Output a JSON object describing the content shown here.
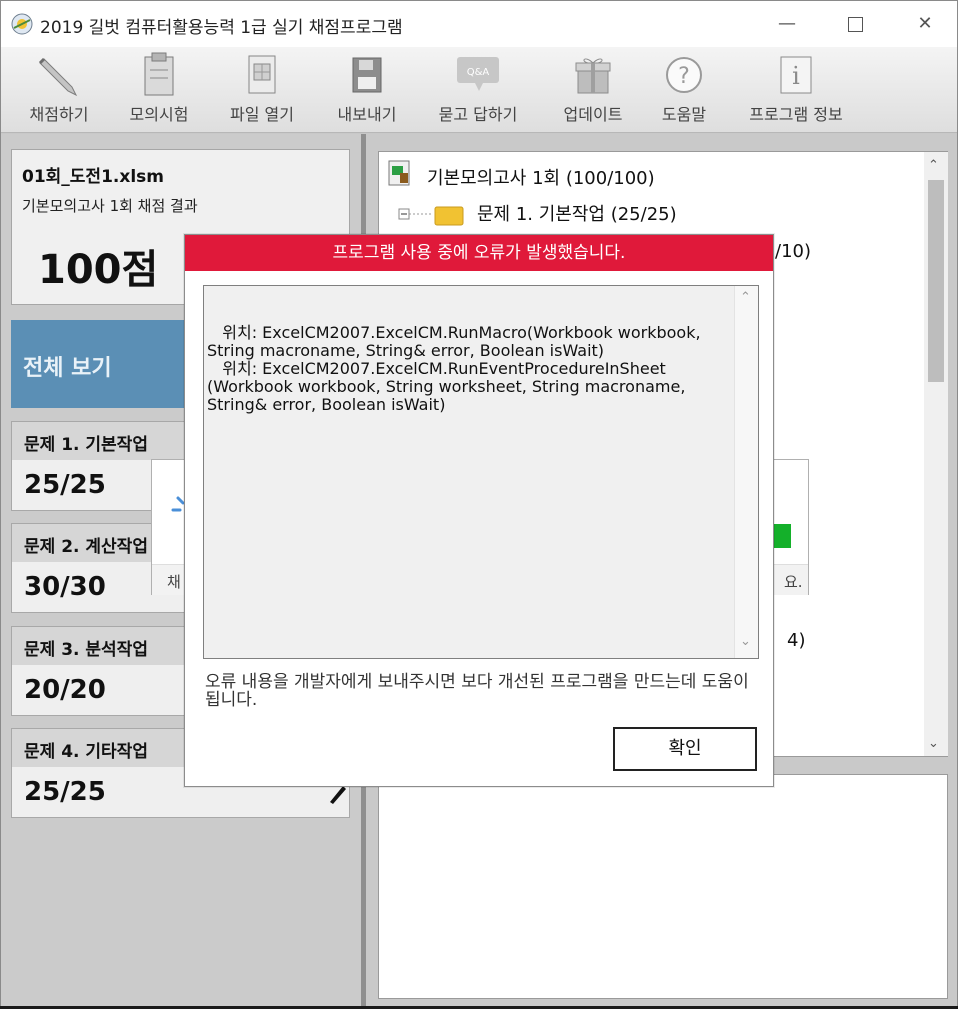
{
  "window": {
    "title": "2019 길벗 컴퓨터활용능력 1급 실기 채점프로그램",
    "controls": {
      "minimize": "—",
      "maximize": "□",
      "close": "✕"
    }
  },
  "toolbar": {
    "items": [
      {
        "label": "채점하기",
        "icon": "pencil-icon"
      },
      {
        "label": "모의시험",
        "icon": "clipboard-icon"
      },
      {
        "label": "파일 열기",
        "icon": "spreadsheet-file-icon"
      },
      {
        "label": "내보내기",
        "icon": "floppy-disk-icon"
      },
      {
        "label": "묻고 답하기",
        "icon": "qa-bubble-icon",
        "badge": "Q&A"
      },
      {
        "label": "업데이트",
        "icon": "gift-icon"
      },
      {
        "label": "도움말",
        "icon": "question-icon",
        "glyph": "?"
      },
      {
        "label": "프로그램 정보",
        "icon": "info-icon",
        "glyph": "i"
      }
    ]
  },
  "left": {
    "file_name": "01회_도전1.xlsm",
    "result_label": "기본모의고사 1회 채점 결과",
    "score": "100점",
    "overall_label": "전체 보기",
    "questions": [
      {
        "title": "문제 1. 기본작업",
        "score": "25/25"
      },
      {
        "title": "문제 2. 계산작업",
        "score": "30/30"
      },
      {
        "title": "문제 3. 분석작업",
        "score": "20/20"
      },
      {
        "title": "문제 4. 기타작업",
        "score": "25/25"
      }
    ]
  },
  "tree": {
    "root": "기본모의고사 1회 (100/100)",
    "folder1": "문제 1. 기본작업 (25/25)",
    "partial1": "/10)",
    "partial2": "4)"
  },
  "loading": {
    "text_left": "채",
    "text_right": "요."
  },
  "dialog": {
    "title": "프로그램 사용 중에 오류가 발생했습니다.",
    "body": "   위치: ExcelCM2007.ExcelCM.RunMacro(Workbook workbook, String macroname, String& error, Boolean isWait)\n   위치: ExcelCM2007.ExcelCM.RunEventProcedureInSheet (Workbook workbook, String worksheet, String macroname, String& error, Boolean isWait)",
    "message": "오류 내용을 개발자에게 보내주시면 보다 개선된 프로그램을 만드는데 도움이 됩니다.",
    "ok_label": "확인"
  },
  "colors": {
    "dialog_header": "#e0193a",
    "overall_bg": "#5b8fb5",
    "status_green": "#14b02a"
  }
}
